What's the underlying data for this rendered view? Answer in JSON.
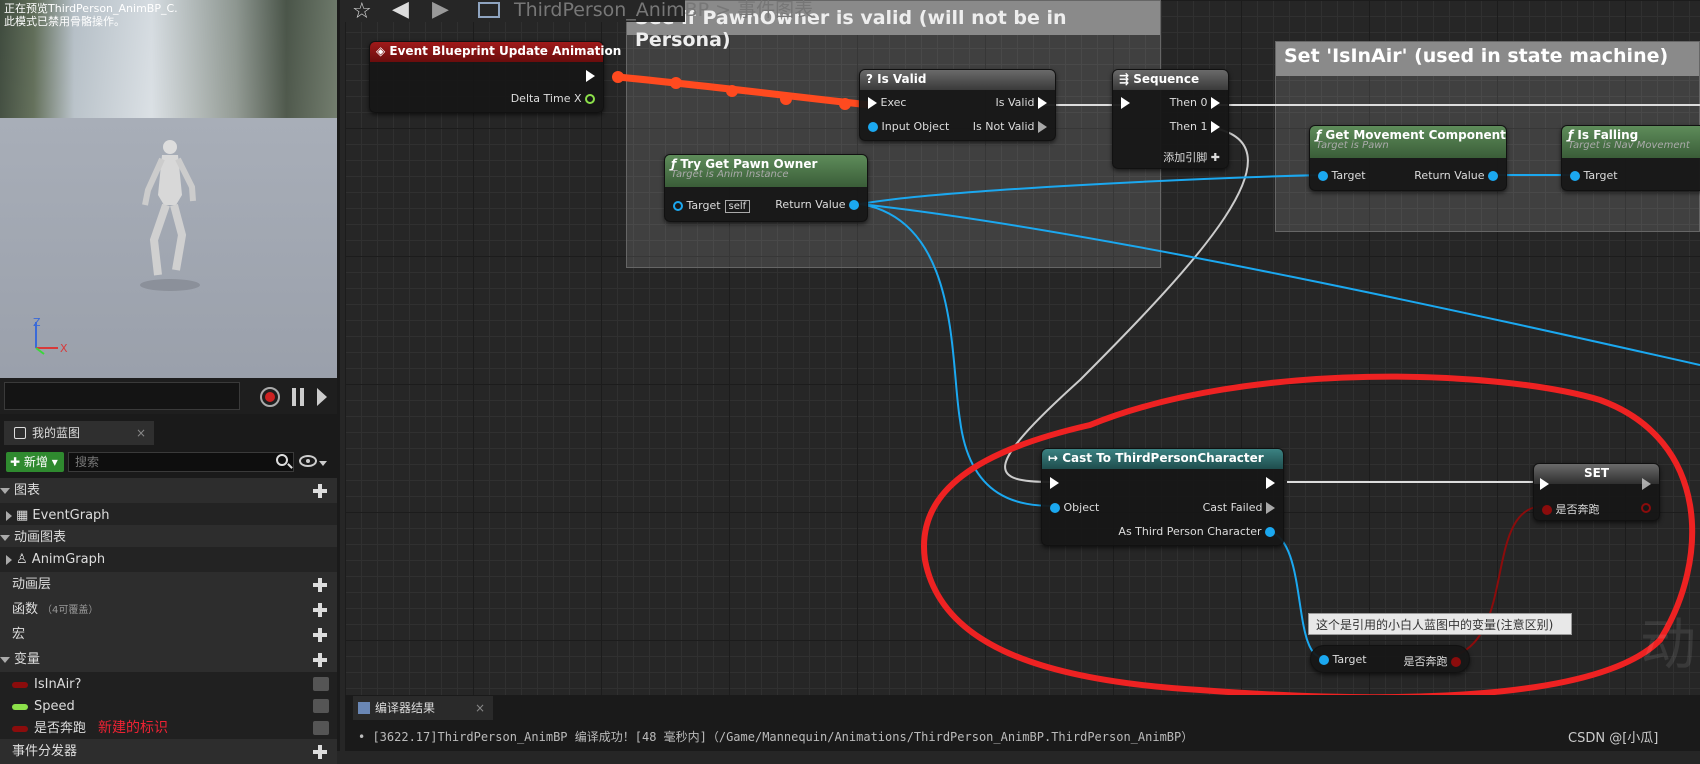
{
  "viewport": {
    "msg_line1": "正在预览ThirdPerson_AnimBP_C.",
    "msg_line2": "此模式已禁用骨骼操作。"
  },
  "panel": {
    "tab": "我的蓝图",
    "new_label": "新增",
    "search_placeholder": "搜索",
    "rows": {
      "graphs": "图表",
      "eventgraph": "EventGraph",
      "animgraphs": "动画图表",
      "animgraph": "AnimGraph",
      "animlayers": "动画层",
      "functions": "函数",
      "functions_note": "（4可覆盖）",
      "macros": "宏",
      "variables": "变量",
      "var1": "IsInAir?",
      "var2": "Speed",
      "var3": "是否奔跑",
      "var3_note": "新建的标识",
      "dispatchers": "事件分发器"
    }
  },
  "graph": {
    "breadcrumb": "ThirdPerson_AnimBP  >  事件图表",
    "comment1": "See if PawnOwner is valid (will not be in Persona)",
    "comment2": "Set 'IsInAir' (used in state machine)",
    "event_node": {
      "title": "Event Blueprint Update Animation",
      "pin": "Delta Time X"
    },
    "isvalid": {
      "title": "Is Valid",
      "exec": "Exec",
      "input": "Input Object",
      "valid": "Is Valid",
      "notvalid": "Is Not Valid"
    },
    "sequence": {
      "title": "Sequence",
      "then0": "Then 0",
      "then1": "Then 1",
      "add": "添加引脚"
    },
    "pawnowner": {
      "title": "Try Get Pawn Owner",
      "sub": "Target is Anim Instance",
      "target": "Target",
      "self": "self",
      "ret": "Return Value"
    },
    "getmove": {
      "title": "Get Movement Component",
      "sub": "Target is Pawn",
      "target": "Target",
      "ret": "Return Value"
    },
    "isfalling": {
      "title": "Is Falling",
      "sub": "Target is Nav Movement",
      "target": "Target"
    },
    "cast": {
      "title": "Cast To ThirdPersonCharacter",
      "object": "Object",
      "failed": "Cast Failed",
      "as": "As Third Person Character"
    },
    "set": {
      "title": "SET",
      "var": "是否奔跑"
    },
    "getter": {
      "target": "Target",
      "var": "是否奔跑"
    },
    "tooltip": "这个是引用的小白人蓝图中的变量(注意区别)",
    "watermark": "动"
  },
  "bottom": {
    "tab": "编译器结果",
    "log": "•  [3622.17]ThirdPerson_AnimBP 编译成功！[48 毫秒内]（/Game/Mannequin/Animations/ThirdPerson_AnimBP.ThirdPerson_AnimBP）",
    "credit": "CSDN @[小瓜]"
  },
  "colors": {
    "event": "#8a1414",
    "pure_func": "#4d7a4a",
    "cast": "#2e6a6a",
    "exec_wire": "#ff4a1f",
    "object_wire": "#1ba8f0",
    "annotation": "#ee2222"
  }
}
